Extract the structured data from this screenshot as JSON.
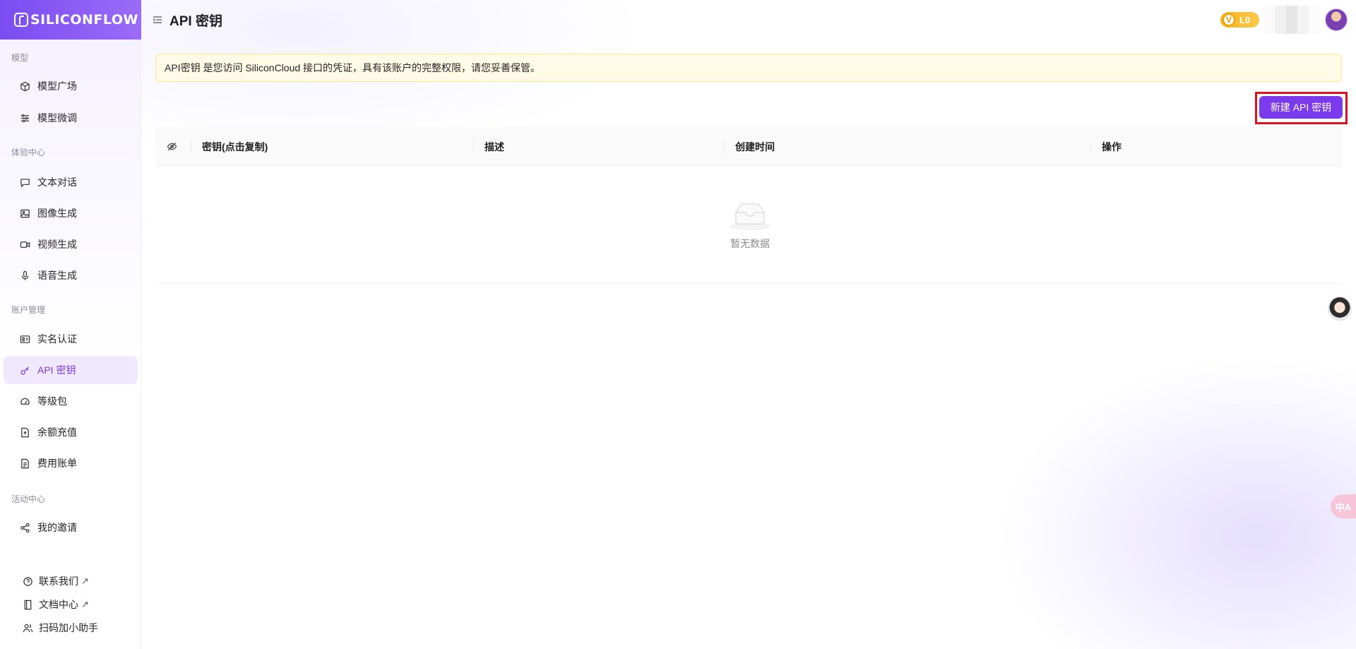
{
  "brand": {
    "name": "SILICONFLOW"
  },
  "header": {
    "title": "API 密钥",
    "vip_letter": "V",
    "vip_level": "L0"
  },
  "sidebar": {
    "sections": [
      {
        "label": "模型"
      },
      {
        "label": "体验中心"
      },
      {
        "label": "账户管理"
      },
      {
        "label": "活动中心"
      }
    ],
    "items": [
      {
        "label": "模型广场",
        "icon": "cube-icon"
      },
      {
        "label": "模型微调",
        "icon": "sliders-icon"
      },
      {
        "label": "文本对话",
        "icon": "chat-icon"
      },
      {
        "label": "图像生成",
        "icon": "image-icon"
      },
      {
        "label": "视频生成",
        "icon": "video-icon"
      },
      {
        "label": "语音生成",
        "icon": "microphone-icon"
      },
      {
        "label": "实名认证",
        "icon": "id-card-icon"
      },
      {
        "label": "API 密钥",
        "icon": "key-icon",
        "active": true
      },
      {
        "label": "等级包",
        "icon": "gauge-icon"
      },
      {
        "label": "余额充值",
        "icon": "recharge-icon"
      },
      {
        "label": "费用账单",
        "icon": "bill-icon"
      },
      {
        "label": "我的邀请",
        "icon": "share-icon"
      }
    ],
    "footer": [
      {
        "label": "联系我们",
        "icon": "help-circle-icon",
        "external": "↗"
      },
      {
        "label": "文档中心",
        "icon": "book-icon",
        "external": "↗"
      },
      {
        "label": "扫码加小助手",
        "icon": "users-icon"
      }
    ]
  },
  "notice": {
    "text": "API密钥 是您访问 SiliconCloud 接口的凭证，具有该账户的完整权限，请您妥善保管。"
  },
  "actions": {
    "create_label": "新建 API 密钥"
  },
  "table": {
    "columns": [
      "密钥(点击复制)",
      "描述",
      "创建时间",
      "操作"
    ],
    "rows": [],
    "empty_text": "暂无数据"
  },
  "floating": {
    "translate_label": "中A"
  },
  "colors": {
    "accent": "#7c3aed",
    "highlight_box": "#e0101f",
    "notice_bg": "#fffbe6"
  }
}
